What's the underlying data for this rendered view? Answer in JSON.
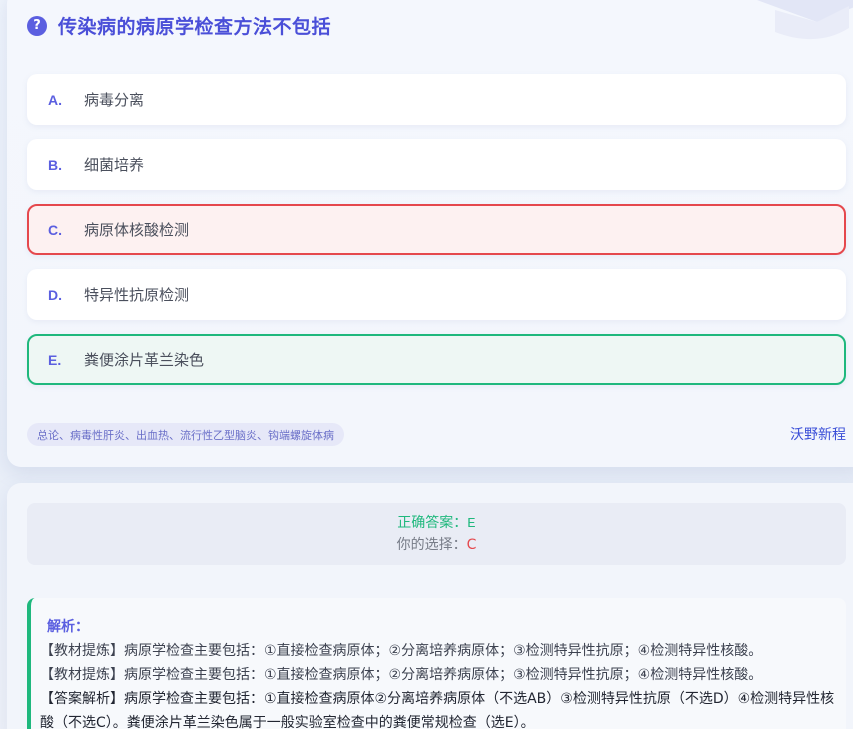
{
  "question": {
    "title": "传染病的病原学检查方法不包括",
    "icon": "question-icon"
  },
  "options": [
    {
      "letter": "A.",
      "text": "病毒分离",
      "state": "normal"
    },
    {
      "letter": "B.",
      "text": "细菌培养",
      "state": "normal"
    },
    {
      "letter": "C.",
      "text": "病原体核酸检测",
      "state": "wrong"
    },
    {
      "letter": "D.",
      "text": "特异性抗原检测",
      "state": "normal"
    },
    {
      "letter": "E.",
      "text": "粪便涂片革兰染色",
      "state": "correct"
    }
  ],
  "tag": "总论、病毒性肝炎、出血热、流行性乙型脑炎、钩端螺旋体病",
  "source": "沃野新程",
  "answer": {
    "correct_label": "正确答案：",
    "correct_value": "E",
    "choice_label": "你的选择：",
    "choice_value": "C"
  },
  "analysis": {
    "title": "解析：",
    "lines": [
      "【教材提炼】病原学检查主要包括：①直接检查病原体；②分离培养病原体；③检测特异性抗原；④检测特异性核酸。",
      "【教材提炼】病原学检查主要包括：①直接检查病原体；②分离培养病原体；③检测特异性抗原；④检测特异性核酸。",
      "【答案解析】病原学检查主要包括：①直接检查病原体②分离培养病原体（不选AB）③检测特异性抗原（不选D）④检测特异性核酸（不选C）。粪便涂片革兰染色属于一般实验室检查中的粪便常规检查（选E）。"
    ]
  },
  "colors": {
    "accent": "#5b5fe0",
    "correct": "#1fb87d",
    "wrong": "#e5484d"
  }
}
